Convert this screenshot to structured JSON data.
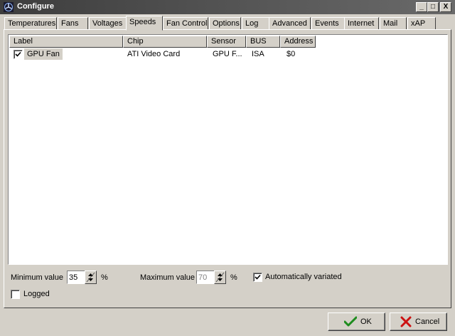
{
  "window": {
    "title": "Configure",
    "controls": {
      "minimize": "_",
      "maximize": "□",
      "close": "X"
    }
  },
  "tabs": [
    {
      "label": "Temperatures"
    },
    {
      "label": "Fans"
    },
    {
      "label": "Voltages"
    },
    {
      "label": "Speeds",
      "active": true
    },
    {
      "label": "Fan Control"
    },
    {
      "label": "Options"
    },
    {
      "label": "Log"
    },
    {
      "label": "Advanced"
    },
    {
      "label": "Events"
    },
    {
      "label": "Internet"
    },
    {
      "label": "Mail"
    },
    {
      "label": "xAP"
    }
  ],
  "table": {
    "columns": [
      "Label",
      "Chip",
      "Sensor",
      "BUS",
      "Address"
    ],
    "rows": [
      {
        "checked": true,
        "label": "GPU Fan",
        "chip": "ATI Video Card",
        "sensor": "GPU F...",
        "bus": "ISA",
        "address": "$0"
      }
    ]
  },
  "settings": {
    "min_label": "Minimum value",
    "min_value": "35",
    "min_unit": "%",
    "max_label": "Maximum value",
    "max_value": "70",
    "max_unit": "%",
    "auto_label": "Automatically variated",
    "auto_checked": true,
    "logged_label": "Logged",
    "logged_checked": false
  },
  "buttons": {
    "ok_label": "OK",
    "cancel_label": "Cancel"
  },
  "colors": {
    "ok_green": "#1e8c1e",
    "cancel_red": "#cc1111",
    "title_bar": "#3d3d3d"
  }
}
